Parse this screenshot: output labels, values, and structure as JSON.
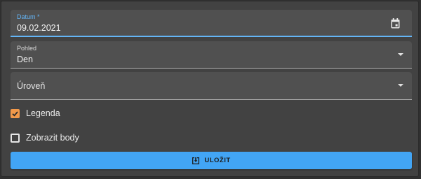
{
  "date_field": {
    "label": "Datum *",
    "value": "09.02.2021",
    "icon": "calendar-icon"
  },
  "view_field": {
    "label": "Pohled",
    "value": "Den",
    "icon": "dropdown-arrow-icon"
  },
  "level_field": {
    "placeholder": "Úroveň",
    "icon": "dropdown-arrow-icon"
  },
  "legend_checkbox": {
    "label": "Legenda",
    "checked": true
  },
  "points_checkbox": {
    "label": "Zobrazit body",
    "checked": false
  },
  "save_button": {
    "label": "ULOŽIT",
    "icon": "save-icon"
  },
  "colors": {
    "accent_focus": "#64b5f6",
    "checkbox_checked": "#f2994a",
    "button_bg": "#42a5f5",
    "panel_bg": "#424242",
    "field_bg": "#505050"
  }
}
